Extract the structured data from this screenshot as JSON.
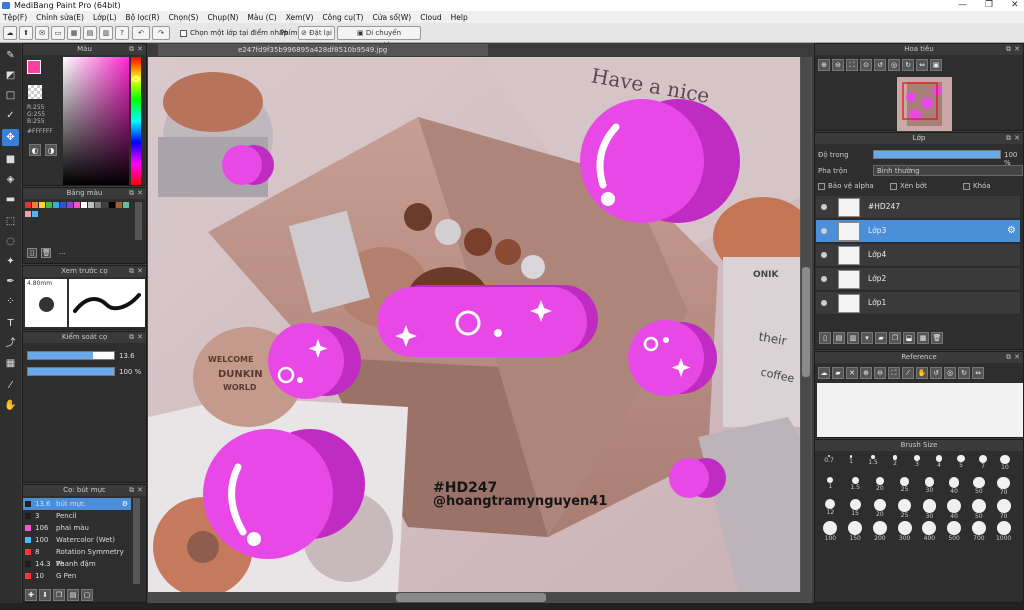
{
  "window": {
    "title": "MediBang Paint Pro (64bit)"
  },
  "menu": [
    "Tệp(F)",
    "Chỉnh sửa(E)",
    "Lớp(L)",
    "Bộ lọc(R)",
    "Chọn(S)",
    "Chụp(N)",
    "Màu (C)",
    "Xem(V)",
    "Công cụ(T)",
    "Cửa sổ(W)",
    "Cloud",
    "Help"
  ],
  "toolbar": {
    "select_layer_label": "Chọn một lớp tại điểm nhấp",
    "phim_label": "Phím",
    "reset_label": "Đặt lại",
    "move_label": "Di chuyển ngang/dọc"
  },
  "document": {
    "filename": "e247fd9f35b996895a428df8510b9549.jpg"
  },
  "color_panel": {
    "title": "Màu",
    "r": "R:255",
    "g": "G:255",
    "b": "B:255",
    "hex": "#FFFFFF",
    "primary_color": "#ff3fa0",
    "secondary_color": "#ffffff"
  },
  "palette_panel": {
    "title": "Bảng màu",
    "more": "..."
  },
  "preview_panel": {
    "title": "Xem trước cọ",
    "size": "4.80mm"
  },
  "brush_control": {
    "title": "Kiểm soát cọ",
    "size_value": "13.6",
    "size_fraction": 0.75,
    "opacity_value": "100 %",
    "opacity_fraction": 1.0
  },
  "brush_list": {
    "title": "Cọ: bút mực",
    "items": [
      {
        "size": "13.6",
        "name": "bút mực",
        "color": "#1f1f1f",
        "selected": true
      },
      {
        "size": "3",
        "name": "Pencil",
        "color": "#1f1f1f"
      },
      {
        "size": "106",
        "name": "phai màu",
        "color": "#ff55cc"
      },
      {
        "size": "100",
        "name": "Watercolor (Wet)",
        "color": "#4db8ff"
      },
      {
        "size": "8",
        "name": "Rotation Symmetry Pe",
        "color": "#ff3333"
      },
      {
        "size": "14.3",
        "name": "Thanh đậm",
        "color": "#1f1f1f"
      },
      {
        "size": "10",
        "name": "G Pen",
        "color": "#ff3333"
      }
    ]
  },
  "navigator": {
    "title": "Hoa tiêu"
  },
  "layer_panel": {
    "title": "Lớp",
    "opacity_label": "Độ trong",
    "opacity_value": "100 %",
    "opacity_fraction": 1.0,
    "blend_label": "Pha trộn",
    "blend_value": "Bình thường",
    "protect_alpha": "Bảo vệ alpha",
    "clipping": "Xén bớt",
    "lock": "Khóa",
    "layers": [
      {
        "name": "#HD247",
        "selected": false
      },
      {
        "name": "Lớp3",
        "selected": true
      },
      {
        "name": "Lớp4",
        "selected": false
      },
      {
        "name": "Lớp2",
        "selected": false
      },
      {
        "name": "Lớp1",
        "selected": false
      }
    ]
  },
  "reference_panel": {
    "title": "Reference"
  },
  "brush_size_panel": {
    "title": "Brush Size",
    "rows": [
      [
        "0.7",
        "1",
        "1.5",
        "2",
        "3",
        "4",
        "5",
        "7",
        "10"
      ],
      [
        "1",
        "1.5",
        "20",
        "25",
        "30",
        "40",
        "50",
        "70"
      ],
      [
        "12",
        "15",
        "20",
        "25",
        "30",
        "40",
        "50",
        "70"
      ],
      [
        "100",
        "150",
        "200",
        "300",
        "400",
        "500",
        "700",
        "1000"
      ]
    ]
  },
  "canvas_text": {
    "hashtag": "#HD247",
    "handle": "@hoangtramynguyen41",
    "note_line1": "Have a nice",
    "can_welcome": "WELCOME",
    "can_brand": "DUNKIN",
    "can_world": "WORLD",
    "cup_text1": "their",
    "cup_text2": "coffee",
    "cup_brand": "ONIK"
  },
  "colors": {
    "accent": "#4b8fd9",
    "bubble_main": "#e848e6",
    "bubble_shade": "#c02bc2"
  }
}
